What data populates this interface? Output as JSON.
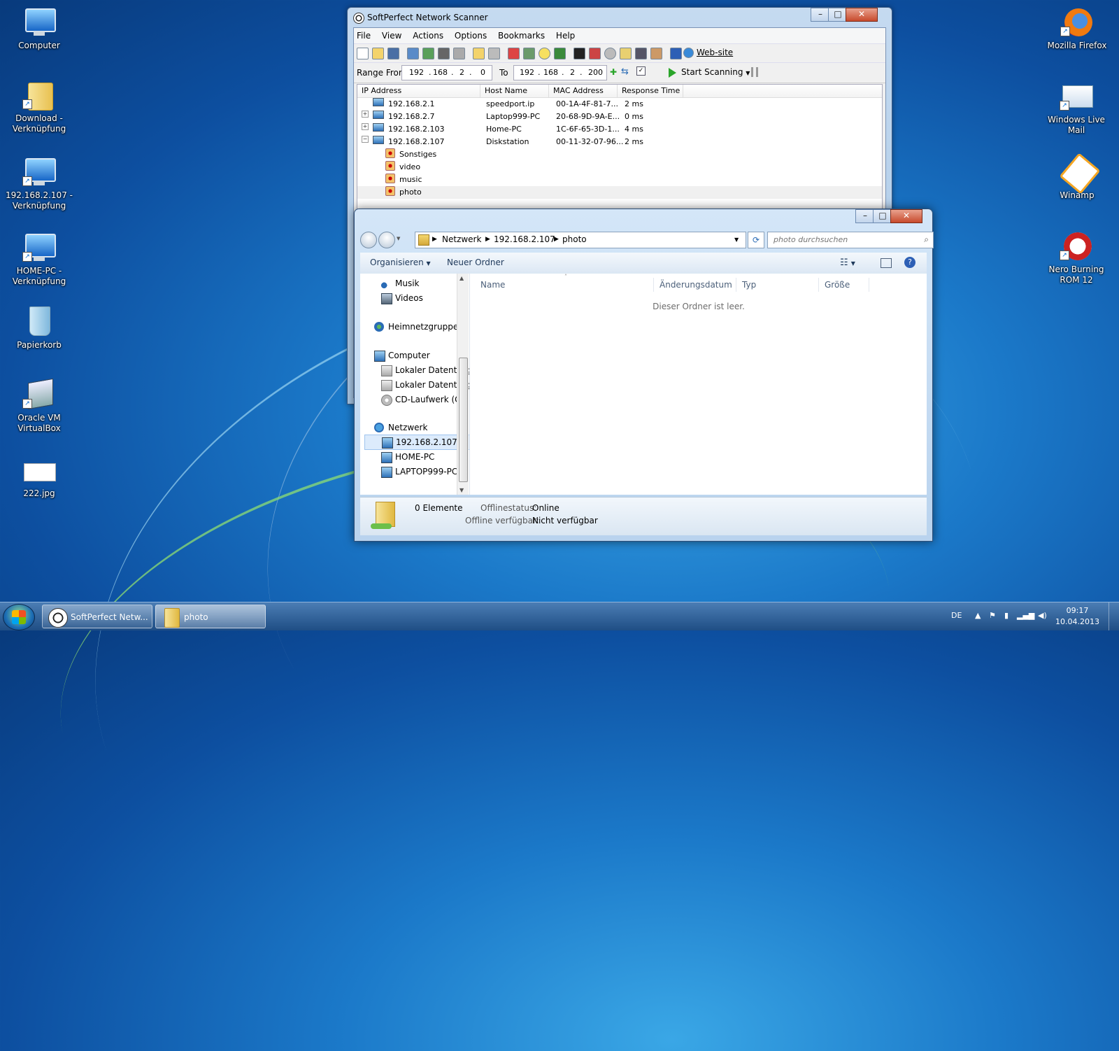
{
  "desktop": {
    "icons_left": [
      {
        "label": "Computer",
        "type": "computer"
      },
      {
        "label": "Download - Verknüpfung",
        "type": "folder"
      },
      {
        "label": "192.168.2.107 - Verknüpfung",
        "type": "computer"
      },
      {
        "label": "HOME-PC - Verknüpfung",
        "type": "computer"
      },
      {
        "label": "Papierkorb",
        "type": "recycle-bin"
      },
      {
        "label": "Oracle VM VirtualBox",
        "type": "virtualbox"
      },
      {
        "label": "222.jpg",
        "type": "image"
      }
    ],
    "icons_right": [
      {
        "label": "Mozilla Firefox",
        "type": "firefox"
      },
      {
        "label": "Windows Live Mail",
        "type": "mail"
      },
      {
        "label": "Winamp",
        "type": "winamp"
      },
      {
        "label": "Nero Burning ROM 12",
        "type": "nero"
      }
    ]
  },
  "scanner": {
    "title": "SoftPerfect Network Scanner",
    "menu": [
      "File",
      "View",
      "Actions",
      "Options",
      "Bookmarks",
      "Help"
    ],
    "website_label": "Web-site",
    "range_from_label": "Range From",
    "range_to_label": "To",
    "range_from": [
      "192",
      "168",
      "2",
      "0"
    ],
    "range_to": [
      "192",
      "168",
      "2",
      "200"
    ],
    "start_label": "Start Scanning",
    "columns": [
      "IP Address",
      "Host Name",
      "MAC Address",
      "Response Time"
    ],
    "rows": [
      {
        "ip": "192.168.2.1",
        "host": "speedport.ip",
        "mac": "00-1A-4F-81-7...",
        "time": "2 ms",
        "expander": ""
      },
      {
        "ip": "192.168.2.7",
        "host": "Laptop999-PC",
        "mac": "20-68-9D-9A-E...",
        "time": "0 ms",
        "expander": "+"
      },
      {
        "ip": "192.168.2.103",
        "host": "Home-PC",
        "mac": "1C-6F-65-3D-1...",
        "time": "4 ms",
        "expander": "+"
      },
      {
        "ip": "192.168.2.107",
        "host": "Diskstation",
        "mac": "00-11-32-07-96...",
        "time": "2 ms",
        "expander": "−"
      }
    ],
    "shares": [
      "Sonstiges",
      "video",
      "music",
      "photo"
    ]
  },
  "explorer": {
    "breadcrumb": [
      "Netzwerk",
      "192.168.2.107",
      "photo"
    ],
    "search_placeholder": "photo durchsuchen",
    "organize_label": "Organisieren",
    "new_folder_label": "Neuer Ordner",
    "nav_items": [
      {
        "label": "Musik",
        "icon": "music"
      },
      {
        "label": "Videos",
        "icon": "video"
      },
      {
        "label": "Heimnetzgruppe",
        "icon": "homegroup"
      },
      {
        "label": "Computer",
        "icon": "computer"
      },
      {
        "label": "Lokaler Datenträg",
        "icon": "drive"
      },
      {
        "label": "Lokaler Datenträg",
        "icon": "drive"
      },
      {
        "label": "CD-Laufwerk (G:)",
        "icon": "cd"
      },
      {
        "label": "Netzwerk",
        "icon": "network"
      },
      {
        "label": "192.168.2.107",
        "icon": "computer"
      },
      {
        "label": "HOME-PC",
        "icon": "computer"
      },
      {
        "label": "LAPTOP999-PC",
        "icon": "computer"
      }
    ],
    "columns": [
      "Name",
      "Änderungsdatum",
      "Typ",
      "Größe"
    ],
    "empty_message": "Dieser Ordner ist leer.",
    "details": {
      "count": "0 Elemente",
      "offline_status_label": "Offlinestatus:",
      "offline_status_value": "Online",
      "offline_avail_label": "Offline verfügbar:",
      "offline_avail_value": "Nicht verfügbar"
    }
  },
  "taskbar": {
    "buttons": [
      {
        "label": "SoftPerfect Netw...",
        "icon": "scanner"
      },
      {
        "label": "photo",
        "icon": "folder"
      }
    ],
    "lang": "DE",
    "time": "09:17",
    "date": "10.04.2013"
  }
}
